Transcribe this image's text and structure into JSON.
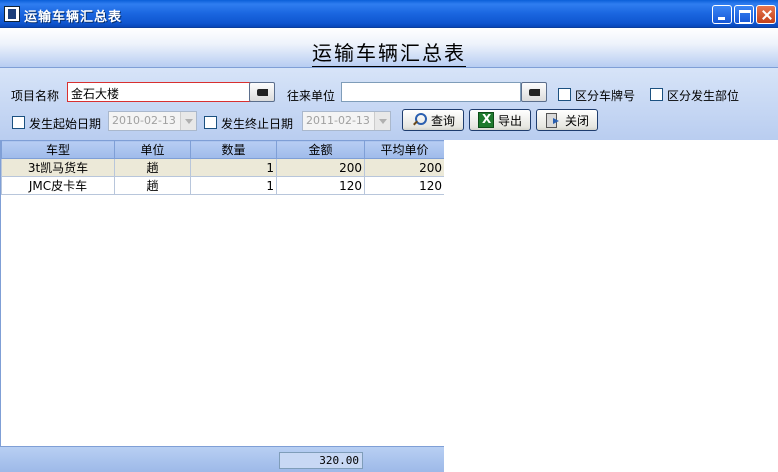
{
  "window": {
    "title": "运输车辆汇总表"
  },
  "page_title": "运输车辆汇总表",
  "filters": {
    "project_label": "项目名称",
    "project_value": "金石大楼",
    "partner_label": "往来单位",
    "partner_value": "",
    "split_plate_label": "区分车牌号",
    "split_dept_label": "区分发生部位",
    "start_date_label": "发生起始日期",
    "start_date_value": "2010-02-13",
    "end_date_label": "发生终止日期",
    "end_date_value": "2011-02-13"
  },
  "buttons": {
    "query": "查询",
    "export": "导出",
    "close": "关闭"
  },
  "table": {
    "columns": [
      "车型",
      "单位",
      "数量",
      "金额",
      "平均单价"
    ],
    "rows": [
      [
        "3t凯马货车",
        "趟",
        "1",
        "200",
        "200"
      ],
      [
        "JMC皮卡车",
        "趟",
        "1",
        "120",
        "120"
      ]
    ]
  },
  "footer": {
    "total_amount": "320.00"
  },
  "colors": {
    "title_bar": "#1a66e0",
    "panel": "#a9c3ef",
    "selected_row": "#ece9d8",
    "focus_border": "#d83030"
  }
}
